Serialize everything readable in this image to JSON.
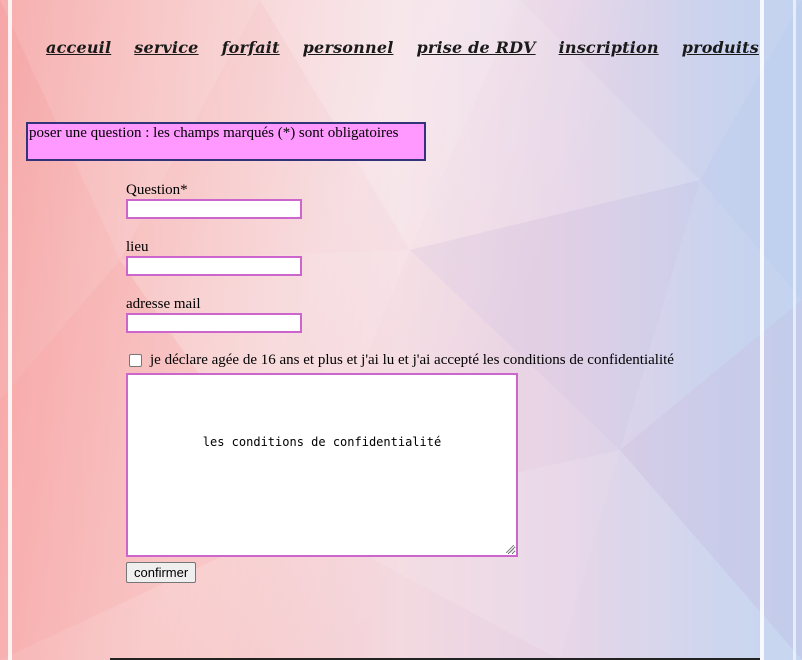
{
  "nav": {
    "items": [
      {
        "label": "acceuil"
      },
      {
        "label": "service"
      },
      {
        "label": "forfait"
      },
      {
        "label": "personnel"
      },
      {
        "label": "prise de RDV"
      },
      {
        "label": "inscription"
      },
      {
        "label": "produits"
      }
    ]
  },
  "notice": {
    "text": "poser une question : les champs marqués (*) sont obligatoires"
  },
  "form": {
    "question_label": "Question*",
    "question_value": "",
    "lieu_label": "lieu",
    "lieu_value": "",
    "email_label": "adresse mail",
    "email_value": "",
    "consent_label": "je déclare agée de 16 ans et plus et j'ai lu et j'ai accepté les conditions de confidentialité",
    "consent_checked": false,
    "conditions_text": "les conditions de confidentialité",
    "submit_label": "confirmer"
  },
  "colors": {
    "notice_bg": "#ff99ff",
    "notice_border": "#33337a",
    "input_border": "#cc66cc"
  }
}
